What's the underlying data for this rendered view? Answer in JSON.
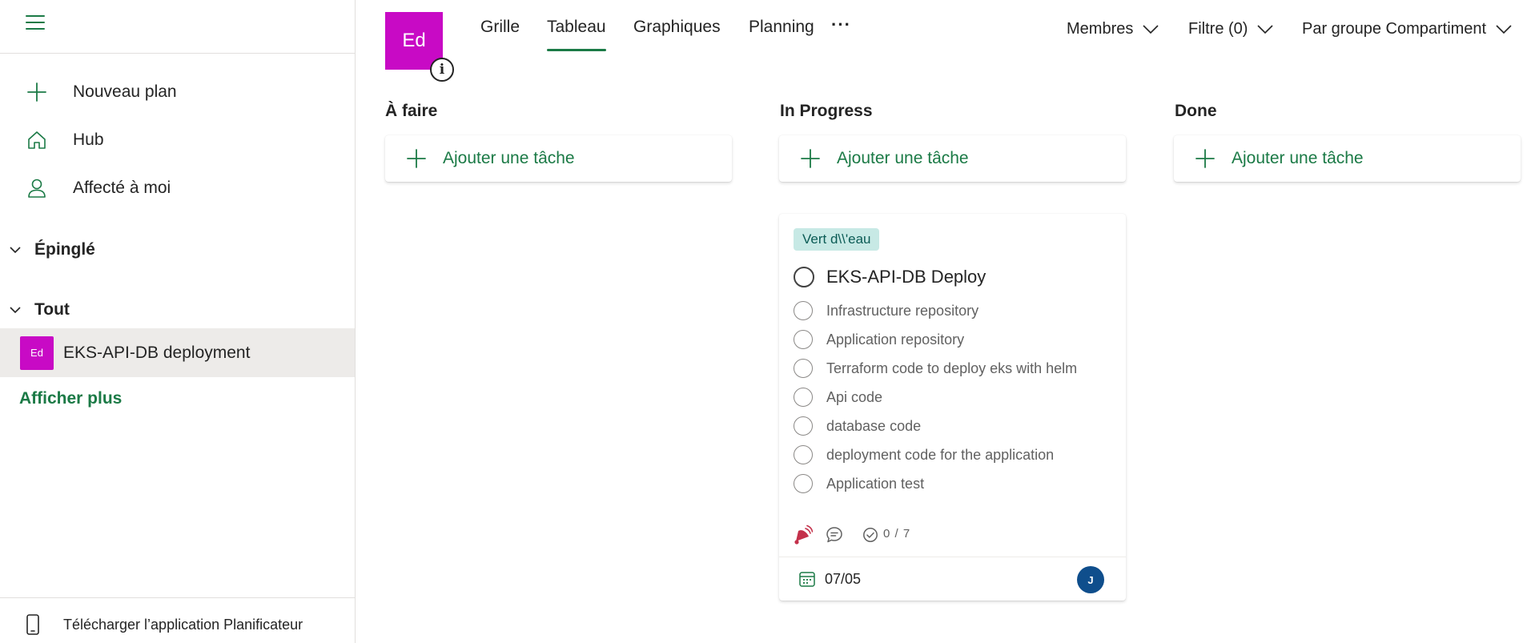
{
  "sidebar": {
    "nav": [
      {
        "label": "Nouveau plan",
        "icon": "plus-icon"
      },
      {
        "label": "Hub",
        "icon": "home-icon"
      },
      {
        "label": "Affecté à moi",
        "icon": "person-icon"
      }
    ],
    "sections": [
      {
        "label": "Épinglé",
        "icon": "chevron-down-icon"
      },
      {
        "label": "Tout",
        "icon": "chevron-down-icon"
      }
    ],
    "plans": [
      {
        "initials": "Ed",
        "name": "EKS-API-DB deployment",
        "color": "#c80ac5"
      }
    ],
    "show_more": "Afficher plus",
    "download": "Télécharger l’application Planificateur"
  },
  "header": {
    "plan_initials": "Ed",
    "plan_color": "#c80ac5",
    "info_glyph": "i",
    "tabs": [
      {
        "label": "Grille",
        "active": false
      },
      {
        "label": "Tableau",
        "active": true
      },
      {
        "label": "Graphiques",
        "active": false
      },
      {
        "label": "Planning",
        "active": false
      }
    ],
    "more": "···",
    "filters": {
      "members": "Membres",
      "filter": "Filtre (0)",
      "group": "Par groupe Compartiment"
    }
  },
  "board": {
    "add_task_label": "Ajouter une tâche",
    "columns": [
      {
        "title": "À faire"
      },
      {
        "title": "In Progress"
      },
      {
        "title": "Done"
      }
    ],
    "task": {
      "label": "Vert d\\\\'eau",
      "label_color": "#c7e9e5",
      "title": "EKS-API-DB Deploy",
      "checklist": [
        "Infrastructure repository",
        "Application repository",
        "Terraform code to deploy eks with helm",
        "Api code",
        "database code",
        "deployment code for the application",
        "Application test"
      ],
      "checklist_count": "0 / 7",
      "priority": "urgent",
      "due_date": "07/05",
      "assignee_initial": "J",
      "assignee_color": "#0f4e8c"
    }
  },
  "colors": {
    "accent": "#1b7a46",
    "selected_bg": "#edebe9"
  }
}
